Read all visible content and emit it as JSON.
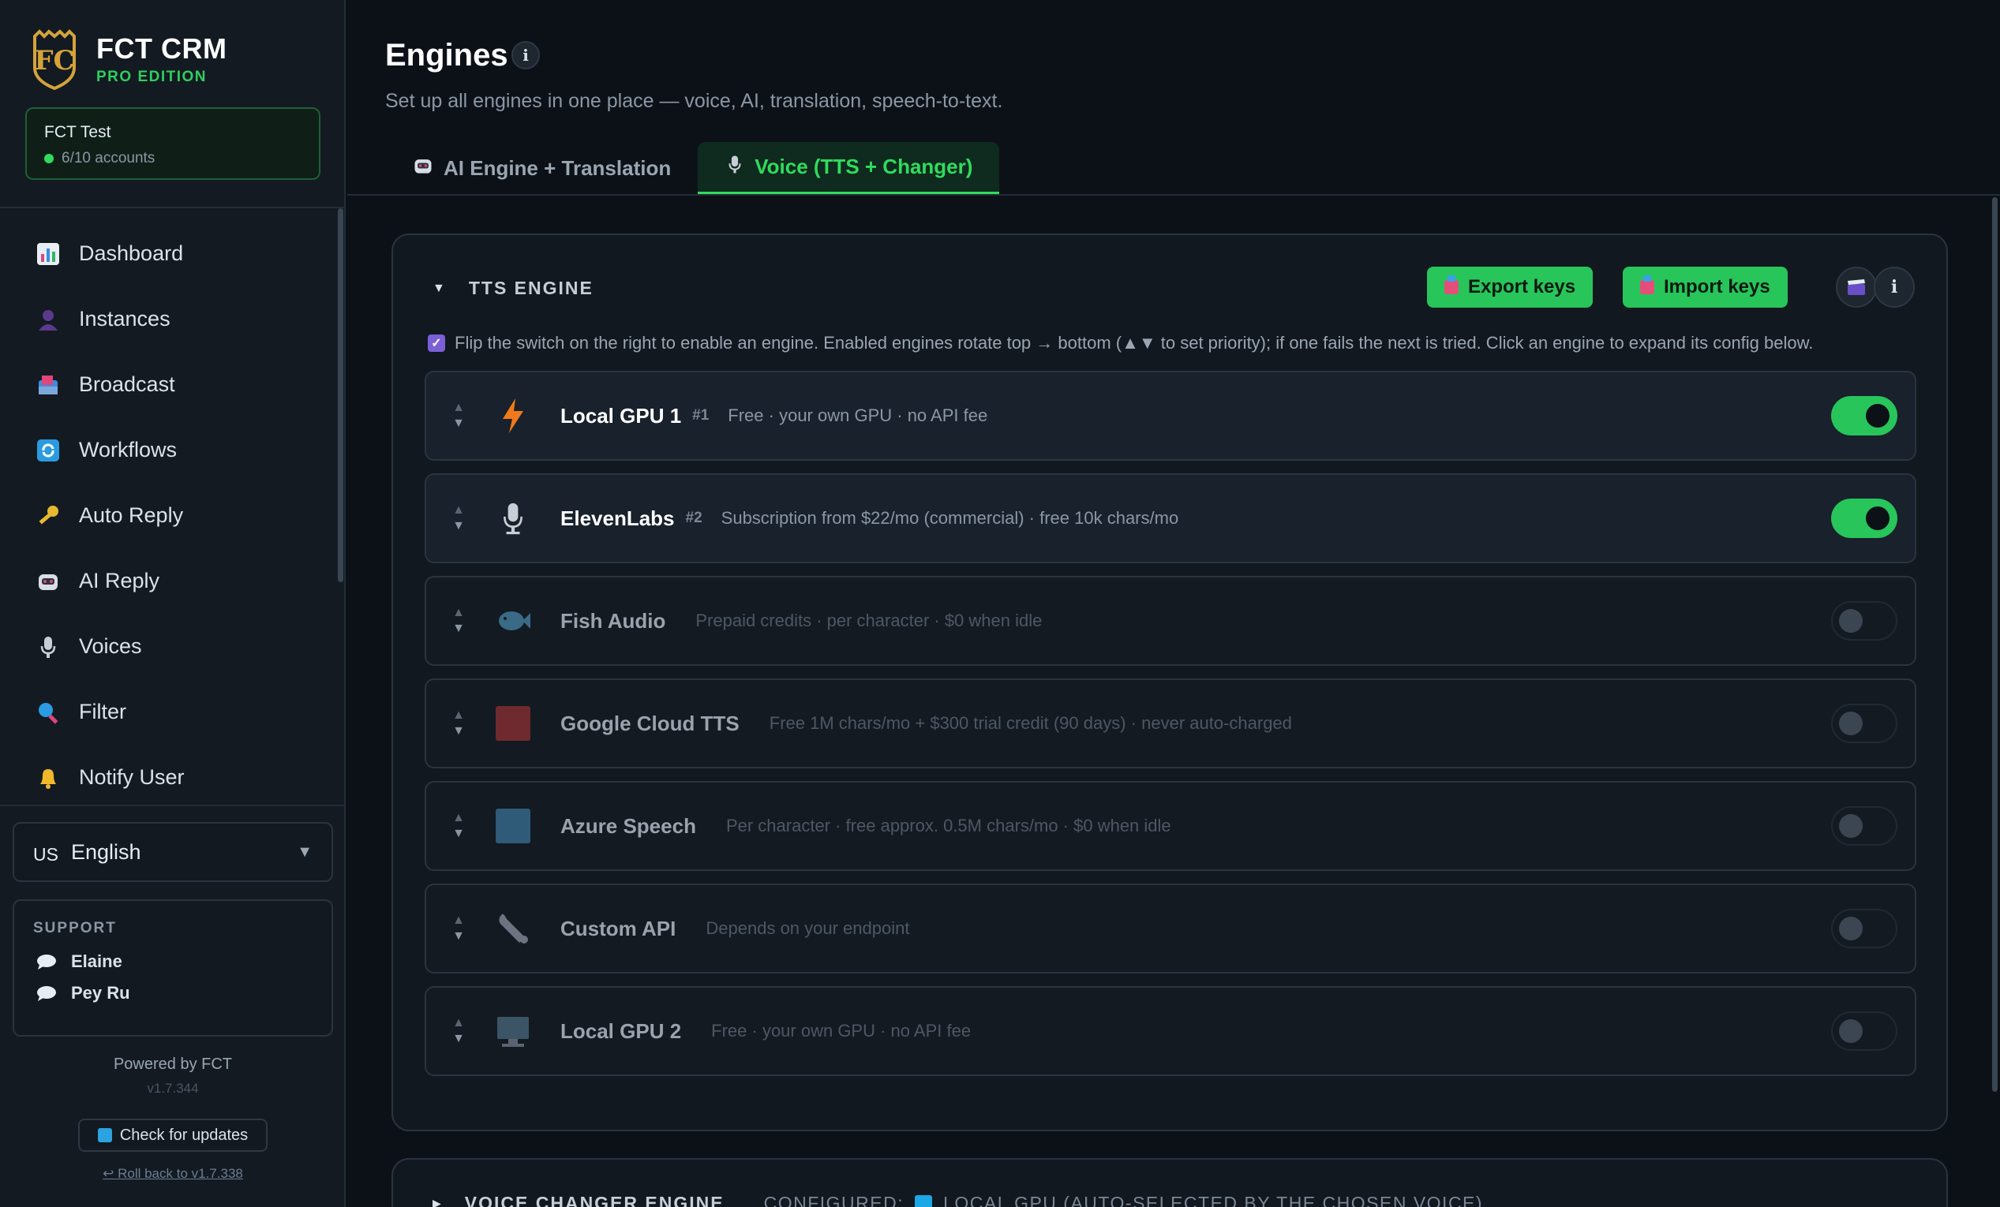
{
  "brand": {
    "name": "FCT CRM",
    "edition": "PRO EDITION"
  },
  "account": {
    "name": "FCT Test",
    "count": "6/10 accounts"
  },
  "nav": [
    {
      "label": "Dashboard",
      "icon": "bar-chart-icon"
    },
    {
      "label": "Instances",
      "icon": "person-icon"
    },
    {
      "label": "Broadcast",
      "icon": "mailbox-icon"
    },
    {
      "label": "Workflows",
      "icon": "refresh-icon"
    },
    {
      "label": "Auto Reply",
      "icon": "key-icon"
    },
    {
      "label": "AI Reply",
      "icon": "robot-icon"
    },
    {
      "label": "Voices",
      "icon": "microphone-icon"
    },
    {
      "label": "Filter",
      "icon": "magnifier-icon"
    },
    {
      "label": "Notify User",
      "icon": "bell-icon"
    }
  ],
  "language": {
    "code": "US",
    "name": "English"
  },
  "support": {
    "title": "SUPPORT",
    "contacts": [
      "Elaine",
      "Pey Ru"
    ]
  },
  "footer": {
    "powered": "Powered by FCT",
    "version": "v1.7.344",
    "update_label": "Check for updates",
    "rollback_label": "↩ Roll back to v1.7.338"
  },
  "page": {
    "title": "Engines",
    "subtitle": "Set up all engines in one place — voice, AI, translation, speech-to-text."
  },
  "tabs": [
    {
      "label": "AI Engine + Translation",
      "icon": "robot-icon",
      "active": false
    },
    {
      "label": "Voice (TTS + Changer)",
      "icon": "microphone-icon",
      "active": true
    }
  ],
  "tts_panel": {
    "title": "TTS ENGINE",
    "export_label": "Export keys",
    "import_label": "Import keys",
    "hint": "Flip the switch on the right to enable an engine. Enabled engines rotate top → bottom (▲▼ to set priority); if one fails the next is tried. Click an engine to expand its config below.",
    "engines": [
      {
        "name": "Local GPU 1",
        "rank": "#1",
        "desc": "Free · your own GPU · no API fee",
        "enabled": true,
        "icon": "lightning-icon"
      },
      {
        "name": "ElevenLabs",
        "rank": "#2",
        "desc": "Subscription from $22/mo (commercial) · free 10k chars/mo",
        "enabled": true,
        "icon": "microphone-icon"
      },
      {
        "name": "Fish Audio",
        "rank": "",
        "desc": "Prepaid credits · per character · $0 when idle",
        "enabled": false,
        "icon": "fish-icon"
      },
      {
        "name": "Google Cloud TTS",
        "rank": "",
        "desc": "Free 1M chars/mo + $300 trial credit (90 days) · never auto-charged",
        "enabled": false,
        "icon": "red-square-icon"
      },
      {
        "name": "Azure Speech",
        "rank": "",
        "desc": "Per character · free approx. 0.5M chars/mo · $0 when idle",
        "enabled": false,
        "icon": "blue-square-icon"
      },
      {
        "name": "Custom API",
        "rank": "",
        "desc": "Depends on your endpoint",
        "enabled": false,
        "icon": "wrench-icon"
      },
      {
        "name": "Local GPU 2",
        "rank": "",
        "desc": "Free · your own GPU · no API fee",
        "enabled": false,
        "icon": "monitor-icon"
      }
    ]
  },
  "vc_panel": {
    "title": "VOICE CHANGER ENGINE",
    "configured_label": "CONFIGURED:",
    "configured_value": "LOCAL GPU (AUTO-SELECTED BY THE CHOSEN VOICE)"
  },
  "colors": {
    "accent": "#28c55a",
    "background": "#0c1117",
    "panel": "#111820"
  }
}
